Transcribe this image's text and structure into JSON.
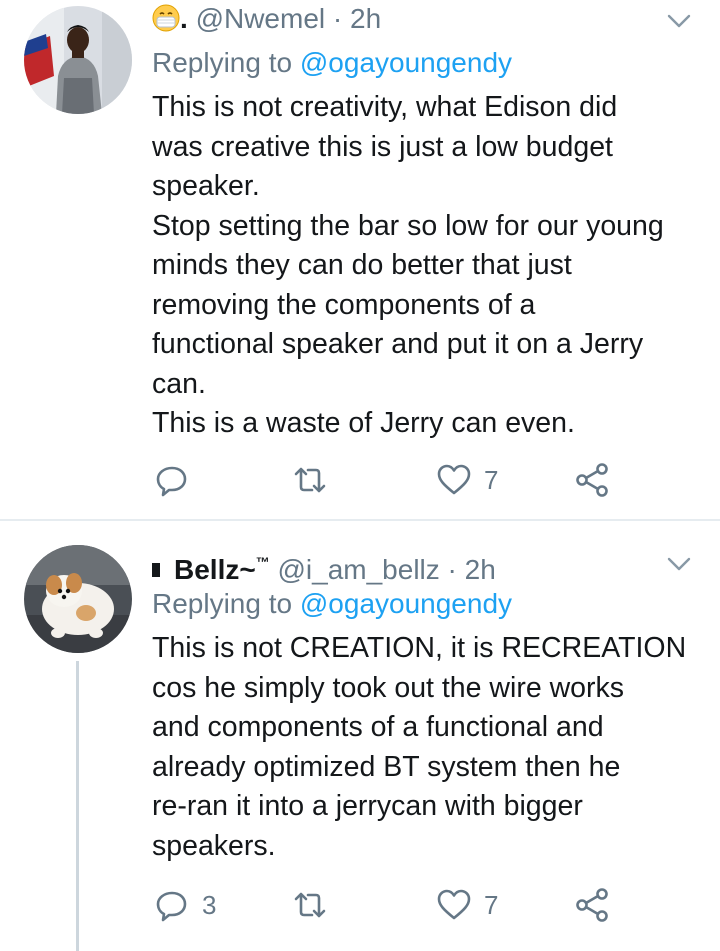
{
  "tweets": [
    {
      "author_emoji": "mask-face-emoji",
      "author_prefix": ".",
      "handle": "@Nwemel",
      "time": "2h",
      "separator": "·",
      "replying_label": "Replying to",
      "replying_to": "@ogayoungendy",
      "lines": [
        "This is not creativity, what Edison did",
        "was creative this is just a low budget",
        "speaker.",
        "Stop setting the bar so low for our young",
        "minds they can do better that just",
        "removing the components of a",
        "functional speaker and put it on a Jerry",
        "can.",
        "This is a waste of Jerry can even."
      ],
      "reply_count": "",
      "retweet_count": "",
      "like_count": "7"
    },
    {
      "display_name": "Bellz~",
      "badge": "™",
      "handle": "@i_am_bellz",
      "time": "2h",
      "separator": "·",
      "replying_label": "Replying to",
      "replying_to": "@ogayoungendy",
      "lines": [
        "This is not CREATION, it is RECREATION",
        "cos he simply took out the wire works",
        "and components of a functional and",
        "already optimized BT system then he",
        "re-ran it into a jerrycan with bigger",
        "speakers."
      ],
      "reply_count": "3",
      "retweet_count": "",
      "like_count": "7"
    }
  ],
  "colors": {
    "text": "#14171a",
    "muted": "#657786",
    "link": "#1da1f2",
    "divider": "#e6ecf0"
  },
  "icons": [
    "reply-icon",
    "retweet-icon",
    "like-icon",
    "share-icon",
    "chevron-down-icon"
  ]
}
